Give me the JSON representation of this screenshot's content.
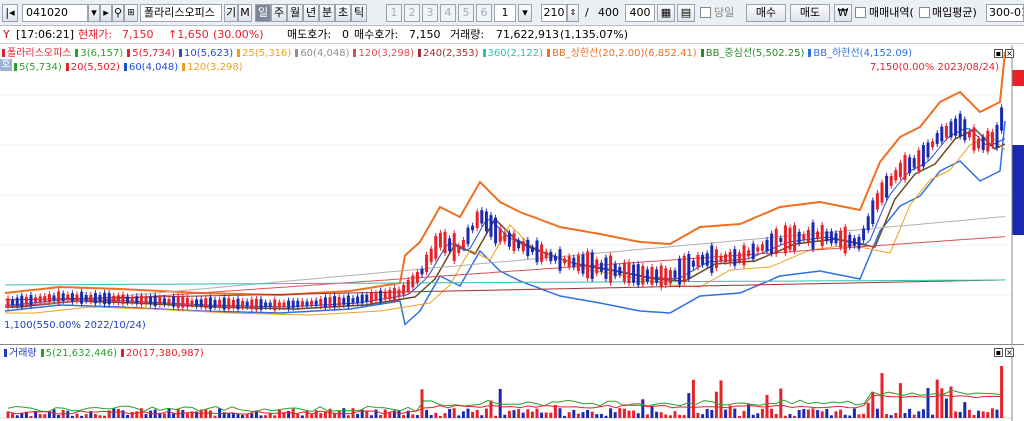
{
  "toolbar": {
    "code": "041020",
    "name": "폴라리스오피스",
    "name_btn_a": "기",
    "name_btn_b": "M",
    "periods": [
      "일",
      "주",
      "월",
      "년",
      "분",
      "초",
      "틱"
    ],
    "active_period": "일",
    "slots": [
      "1",
      "2",
      "3",
      "4",
      "5",
      "6",
      "1"
    ],
    "count": "210",
    "slash": "/",
    "total": "400",
    "total_box": "400",
    "today_label": "당일",
    "buy_label": "매수",
    "sell_label": "매도",
    "won_label": "₩",
    "trade_history_label": "매매내역(",
    "avg_buy_label": "매입평균)",
    "range_label": "300-01"
  },
  "info": {
    "time": "[17:06:21]",
    "current_label": "현재가:",
    "current_price": "7,150",
    "change": "↑1,650",
    "change_pct": "(30.00%)",
    "ask_label": "매도호가:",
    "ask": "0",
    "bid_label": "매수호가:",
    "bid": "7,150",
    "volume_label": "거래량:",
    "volume": "71,622,913",
    "volume_pct": "(1,135.07%)"
  },
  "price_legend": {
    "row1": [
      {
        "text": "폴라리스오피스",
        "color": "#e8202a"
      },
      {
        "text": "3(6,157)",
        "color": "#2aa02a"
      },
      {
        "text": "5(5,734)",
        "color": "#e8202a"
      },
      {
        "text": "10(5,623)",
        "color": "#2050d0"
      },
      {
        "text": "25(5,316)",
        "color": "#f0a020"
      },
      {
        "text": "60(4,048)",
        "color": "#909090"
      },
      {
        "text": "120(3,298)",
        "color": "#e05050"
      },
      {
        "text": "240(2,353)",
        "color": "#a03030"
      },
      {
        "text": "360(2,122)",
        "color": "#30c0b0"
      },
      {
        "text": "BB_상한선(20,2.00)(6,852.41)",
        "color": "#f07020"
      },
      {
        "text": "BB_중심선(5,502.25)",
        "color": "#2a8a2a"
      },
      {
        "text": "BB_하한선(4,152.09)",
        "color": "#3070e0"
      }
    ],
    "row2": [
      {
        "text": "5(5,734)",
        "color": "#2aa02a"
      },
      {
        "text": "20(5,502)",
        "color": "#e8202a"
      },
      {
        "text": "60(4,048)",
        "color": "#2050d0"
      },
      {
        "text": "120(3,298)",
        "color": "#f0a020"
      }
    ],
    "side_tag": "호",
    "high_note": "7,150(0.00% 2023/08/24)",
    "low_note": "1,100(550.00% 2022/10/24)"
  },
  "volume_legend": [
    {
      "text": "거래량",
      "color": "#2040c0"
    },
    {
      "text": "5(21,632,446)",
      "color": "#2aa02a"
    },
    {
      "text": "20(17,380,987)",
      "color": "#e8202a"
    }
  ],
  "colors": {
    "up": "#e8202a",
    "down": "#1a2ab0",
    "bb_upper": "#f07020",
    "bb_lower": "#3070e0",
    "bb_mid": "#6a4a20"
  }
}
